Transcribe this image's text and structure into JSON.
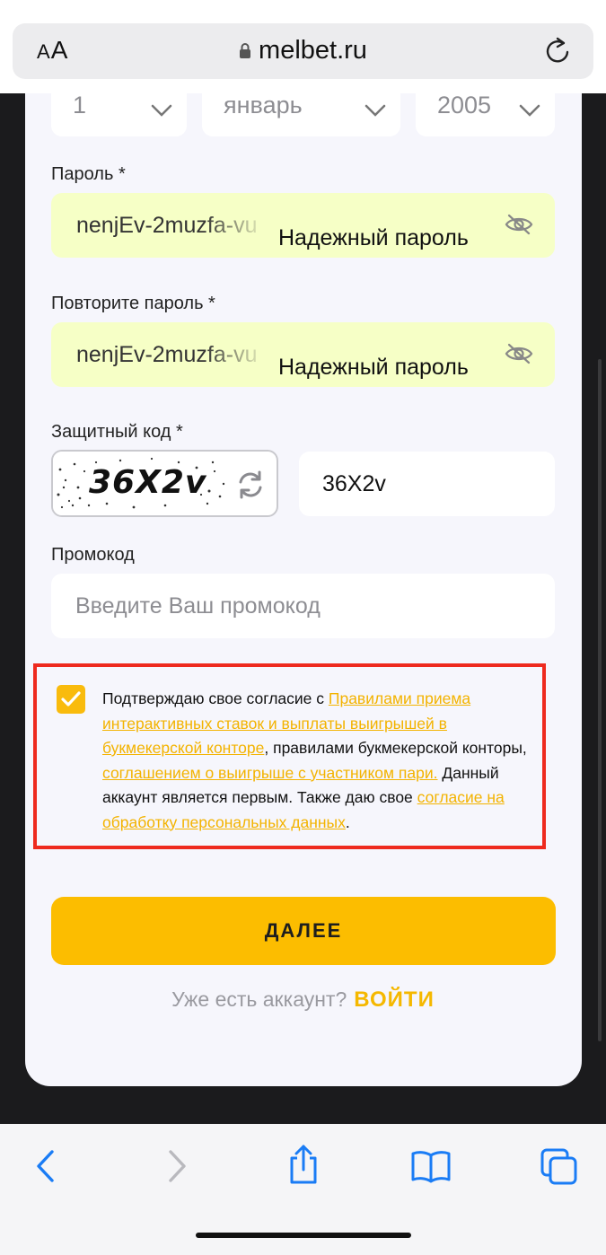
{
  "browser": {
    "aa_small": "A",
    "aa_large": "A",
    "url": "melbet.ru"
  },
  "birthdate": {
    "day": "1",
    "month": "январь",
    "year": "2005"
  },
  "password": {
    "label": "Пароль *",
    "value": "nenjEv-2muzfa-vu",
    "strength": "Надежный пароль"
  },
  "repeat_password": {
    "label": "Повторите пароль *",
    "value": "nenjEv-2muzfa-vu",
    "strength": "Надежный пароль"
  },
  "captcha": {
    "label": "Защитный код *",
    "image_text": "36X2v",
    "input_value": "36X2v"
  },
  "promo": {
    "label": "Промокод",
    "placeholder": "Введите Ваш промокод"
  },
  "agreement": {
    "checked": true,
    "text_1": "Подтверждаю свое согласие с ",
    "link_1": "Правилами приема интерактивных ставок и выплаты выигрышей в букмекерской конторе",
    "text_2": ", правилами букмекерской конторы, ",
    "link_2": "соглашением о выигрыше с участником пари.",
    "text_3": " Данный аккаунт является первым. Также даю свое ",
    "link_3": "согласие на обработку персональных данных",
    "text_4": "."
  },
  "next_button": "ДАЛЕЕ",
  "login": {
    "question": "Уже есть аккаунт?",
    "link": "ВОЙТИ"
  },
  "colors": {
    "accent": "#fcbd00",
    "link": "#f3b300",
    "password_bg": "#f6ffc6",
    "highlight_border": "#ee2a1e",
    "safari_blue": "#1a7cf5"
  }
}
